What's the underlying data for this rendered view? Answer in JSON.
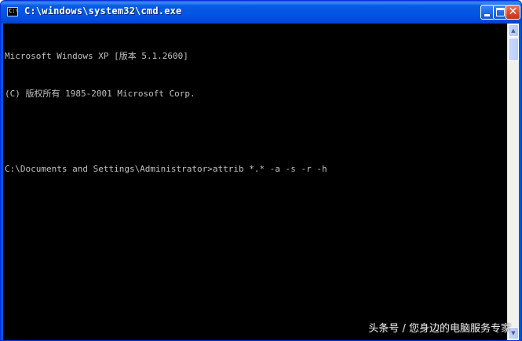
{
  "window": {
    "title": "C:\\windows\\system32\\cmd.exe",
    "icon": "cmd-icon",
    "icon_text": "C:\\"
  },
  "controls": {
    "minimize_icon": "minimize-icon",
    "maximize_icon": "maximize-icon",
    "close_icon": "close-icon",
    "close_glyph": "✕"
  },
  "console": {
    "lines": [
      "Microsoft Windows XP [版本 5.1.2600]",
      "(C) 版权所有 1985-2001 Microsoft Corp.",
      "",
      "C:\\Documents and Settings\\Administrator>attrib *.* -a -s -r -h"
    ],
    "text_color": "#c0c0c0",
    "background": "#000000"
  },
  "scrollbar": {
    "up_arrow": "▲",
    "down_arrow": "▼"
  },
  "watermark": "头条号 / 您身边的电脑服务专家"
}
